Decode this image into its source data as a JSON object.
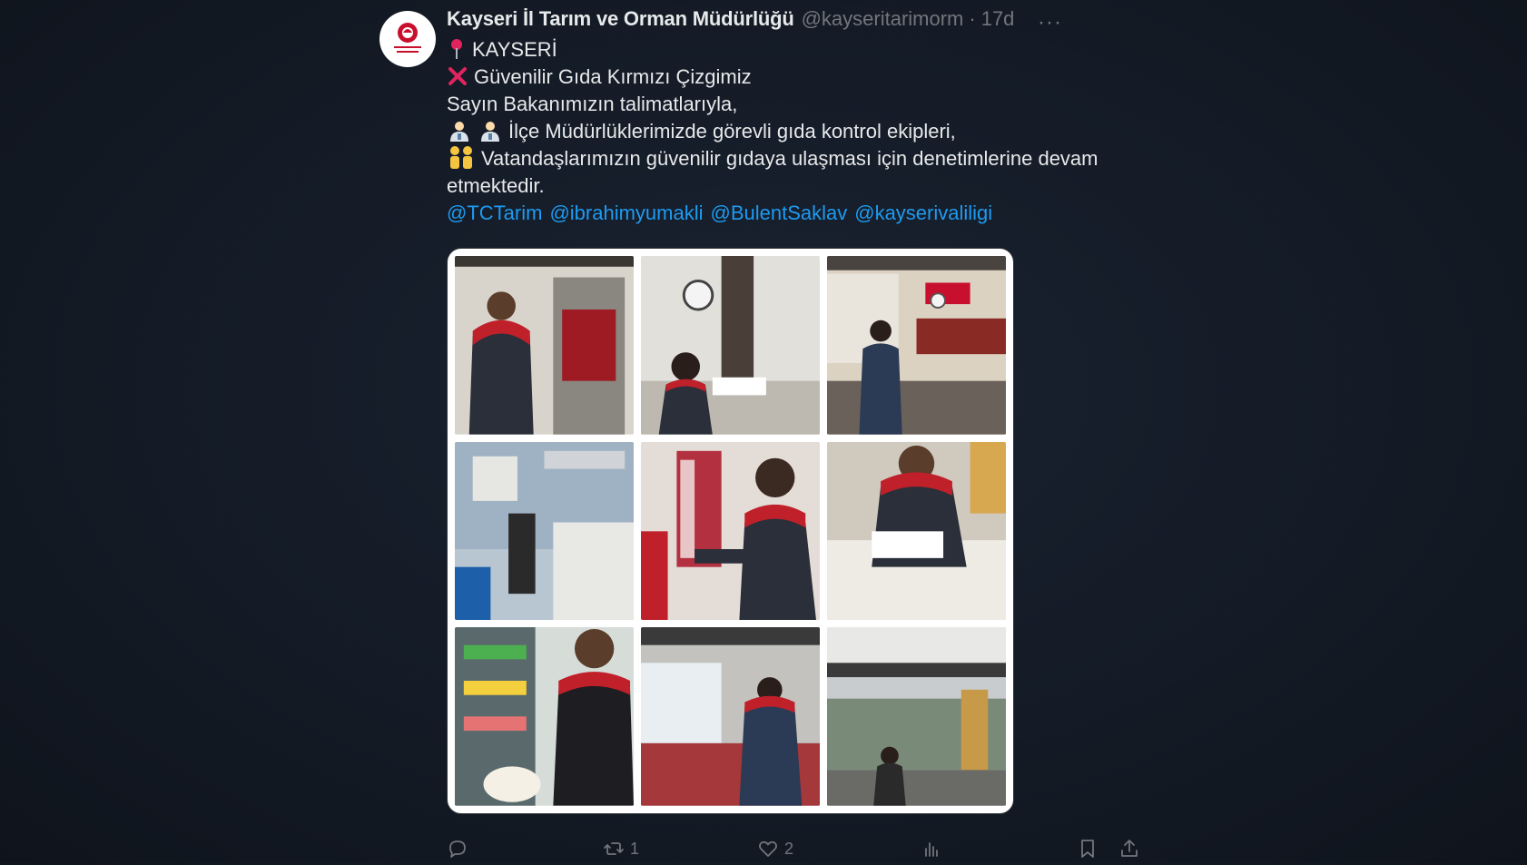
{
  "tweet": {
    "author_name": "Kayseri İl Tarım ve Orman Müdürlüğü",
    "handle": "@kayseritarimorm",
    "separator": "·",
    "time": "17d",
    "more_label": "···",
    "avatar_text": "T.C. TARIM VE ORMAN BAKANLIĞI",
    "lines": [
      "KAYSERİ",
      "Güvenilir Gıda Kırmızı Çizgimiz",
      "Sayın Bakanımızın talimatlarıyla,",
      "İlçe Müdürlüklerimizde görevli gıda kontrol ekipleri,",
      "Vatandaşlarımızın güvenilir gıdaya ulaşması için denetimlerine devam etmektedir."
    ],
    "mentions": [
      "@TCTarim",
      "@ibrahimyumakli",
      "@BulentSaklav",
      "@kayserivaliligi"
    ],
    "photos": [
      "photo-inspector-cold-room",
      "photo-inspectors-office",
      "photo-inspector-butcher-shop",
      "photo-kitchen-inspection",
      "photo-inspector-meat-hanging",
      "photo-inspector-writing-report",
      "photo-inspector-fridge-product",
      "photo-inspector-shop-counter",
      "photo-restaurant-interior"
    ],
    "actions": {
      "reply_count": "",
      "retweet_count": "1",
      "like_count": "2",
      "views_count": ""
    }
  },
  "colors": {
    "background": "#141b26",
    "text": "#e7e9ea",
    "muted": "#71767b",
    "link": "#1d9bf0",
    "uniform_red": "#c0202a"
  }
}
